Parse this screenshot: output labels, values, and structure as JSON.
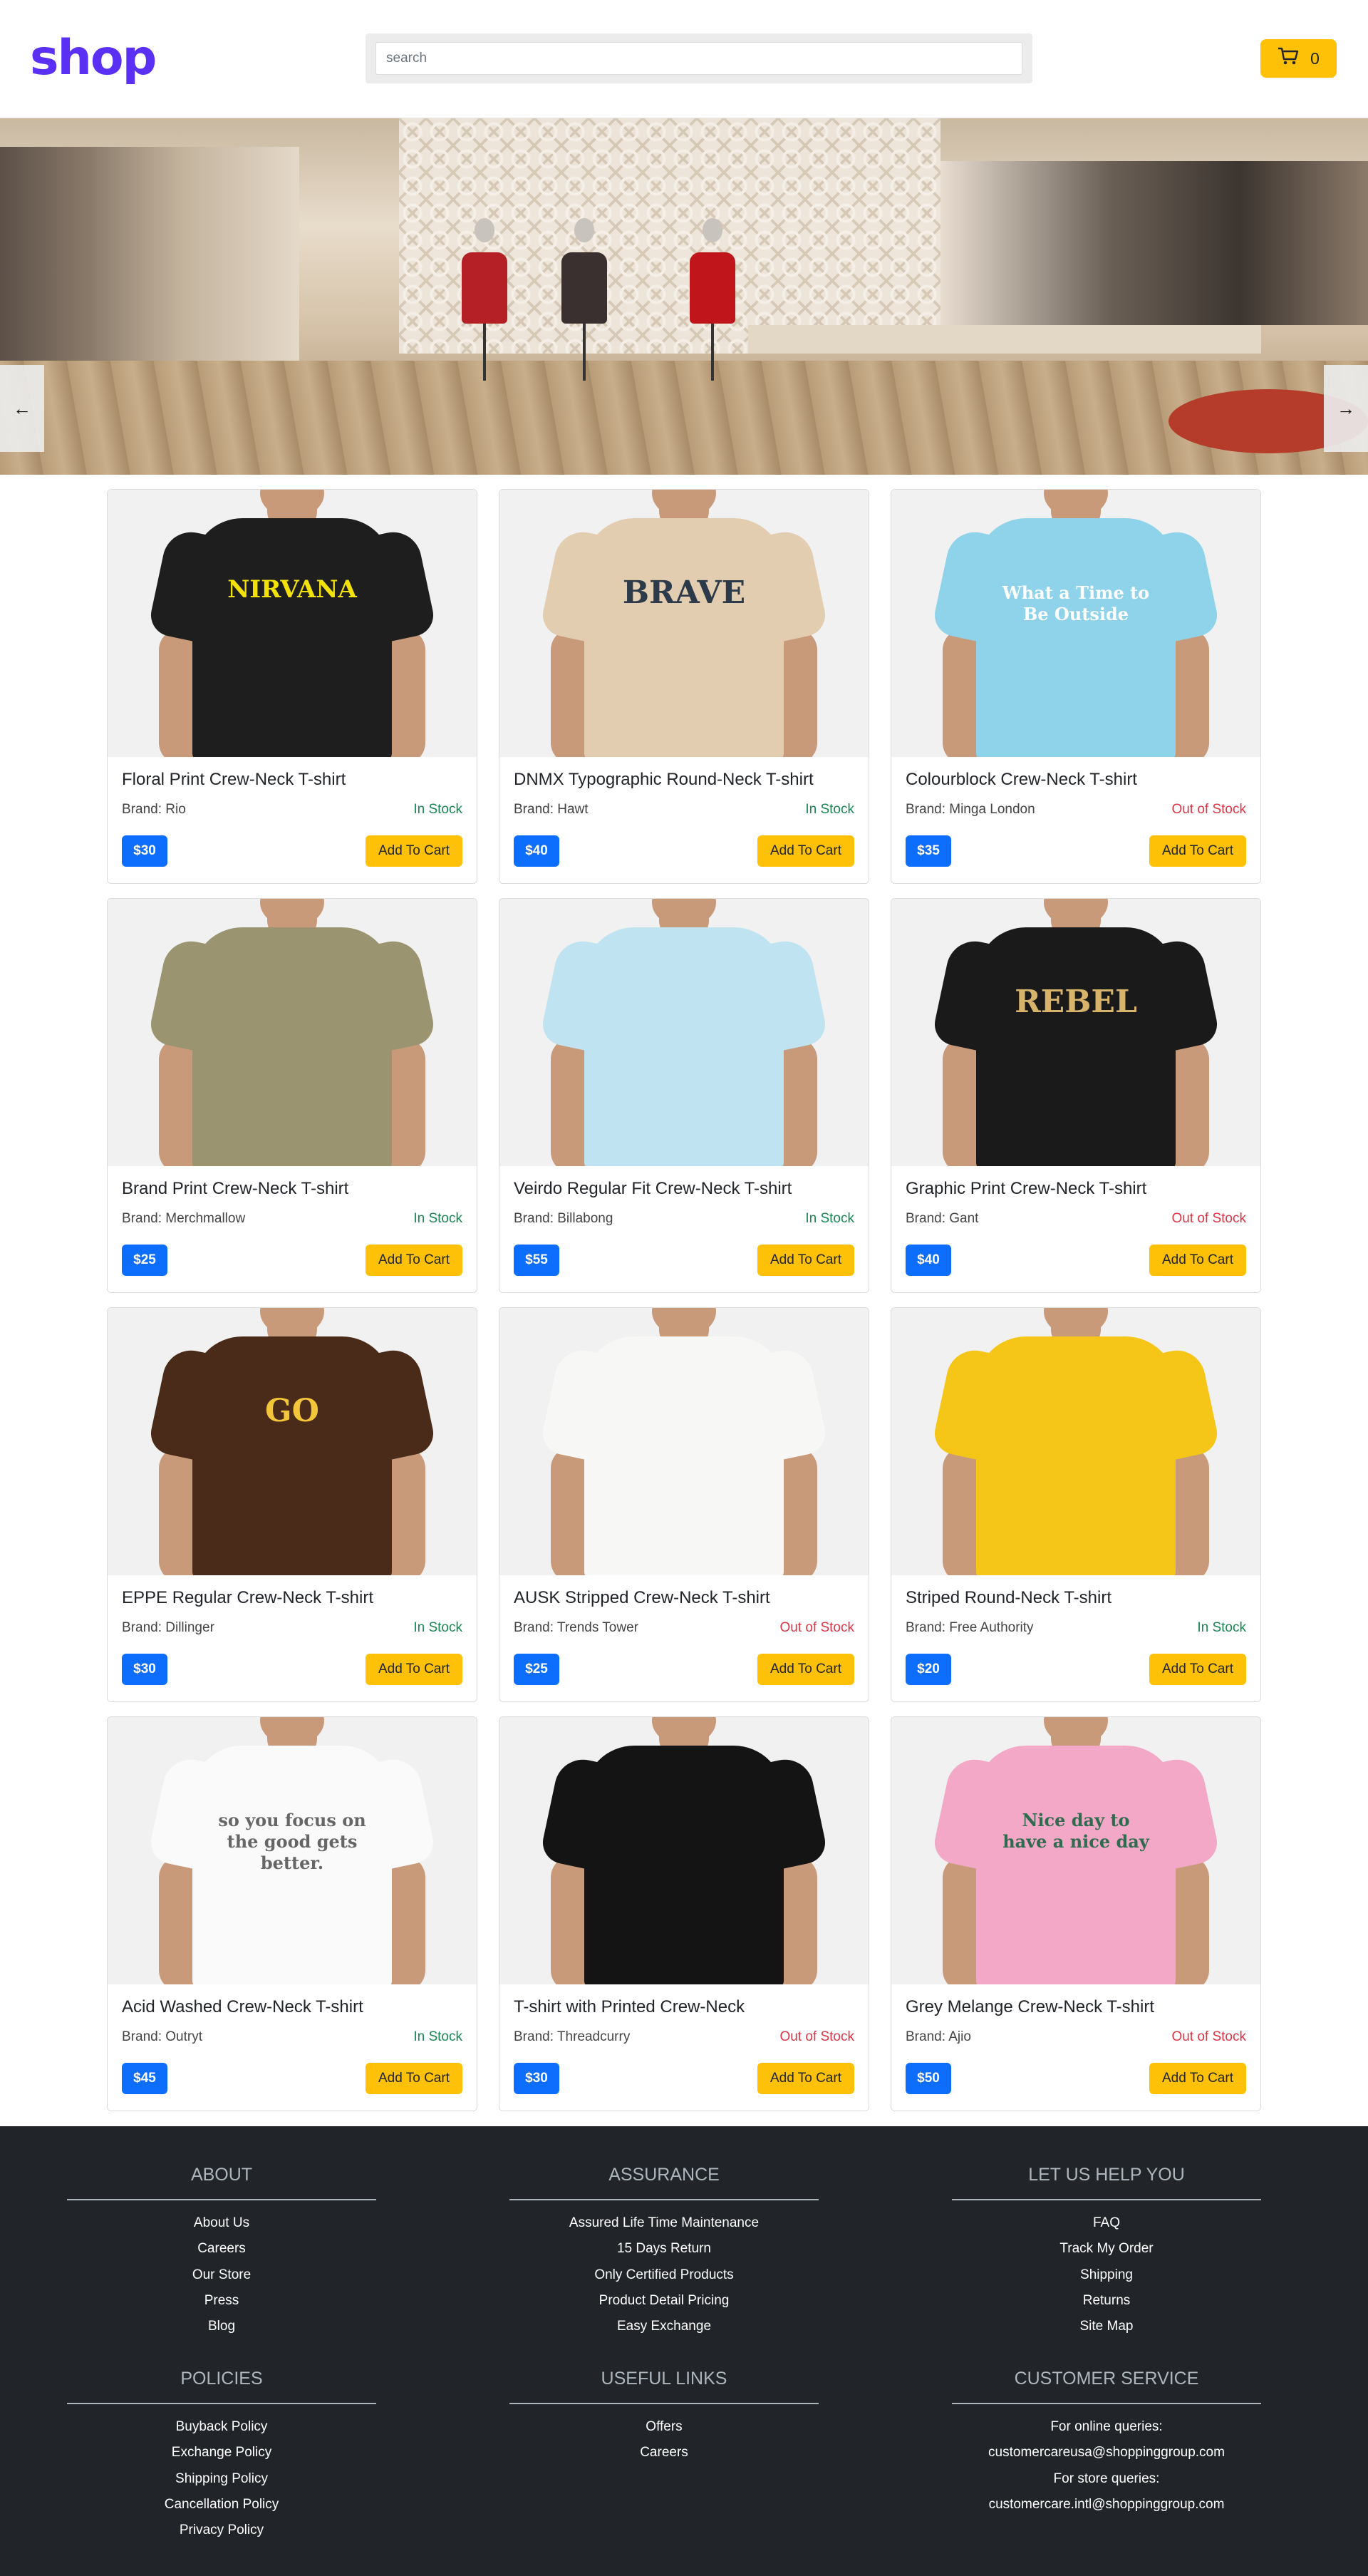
{
  "header": {
    "logo": "shop",
    "search_placeholder": "search",
    "cart_count": "0"
  },
  "banner": {
    "prev_label": "←",
    "next_label": "→"
  },
  "products": [
    {
      "title": "Floral Print Crew-Neck T-shirt",
      "brand": "Brand: Rio",
      "stock": "In Stock",
      "price": "$30",
      "add": "Add To Cart",
      "shirt_color": "#1e1e1e",
      "print": "NIRVANA",
      "print_color": "#f2e205"
    },
    {
      "title": "DNMX Typographic Round-Neck T-shirt",
      "brand": "Brand: Hawt",
      "stock": "In Stock",
      "price": "$40",
      "add": "Add To Cart",
      "shirt_color": "#e3cdb0",
      "print": "BRAVE",
      "print_color": "#2d3a4a"
    },
    {
      "title": "Colourblock Crew-Neck T-shirt",
      "brand": "Brand: Minga London",
      "stock": "Out of Stock",
      "price": "$35",
      "add": "Add To Cart",
      "shirt_color": "#8fd3ea",
      "print": "What a Time to Be Outside",
      "print_color": "#ffffff"
    },
    {
      "title": "Brand Print Crew-Neck T-shirt",
      "brand": "Brand: Merchmallow",
      "stock": "In Stock",
      "price": "$25",
      "add": "Add To Cart",
      "shirt_color": "#9a9470",
      "print": "",
      "print_color": "#ffffff"
    },
    {
      "title": "Veirdo Regular Fit Crew-Neck T-shirt",
      "brand": "Brand: Billabong",
      "stock": "In Stock",
      "price": "$55",
      "add": "Add To Cart",
      "shirt_color": "#bfe3f1",
      "print": "",
      "print_color": "#ffffff"
    },
    {
      "title": "Graphic Print Crew-Neck T-shirt",
      "brand": "Brand: Gant",
      "stock": "Out of Stock",
      "price": "$40",
      "add": "Add To Cart",
      "shirt_color": "#1a1a1a",
      "print": "REBEL",
      "print_color": "#d8b46a"
    },
    {
      "title": "EPPE Regular Crew-Neck T-shirt",
      "brand": "Brand: Dillinger",
      "stock": "In Stock",
      "price": "$30",
      "add": "Add To Cart",
      "shirt_color": "#4a2a18",
      "print": "GO",
      "print_color": "#f2c53a"
    },
    {
      "title": "AUSK Stripped Crew-Neck T-shirt",
      "brand": "Brand: Trends Tower",
      "stock": "Out of Stock",
      "price": "$25",
      "add": "Add To Cart",
      "shirt_color": "#f7f7f5",
      "print": "",
      "print_color": "#cccccc"
    },
    {
      "title": "Striped Round-Neck T-shirt",
      "brand": "Brand: Free Authority",
      "stock": "In Stock",
      "price": "$20",
      "add": "Add To Cart",
      "shirt_color": "#f5c518",
      "print": "",
      "print_color": "#111111"
    },
    {
      "title": "Acid Washed Crew-Neck T-shirt",
      "brand": "Brand: Outryt",
      "stock": "In Stock",
      "price": "$45",
      "add": "Add To Cart",
      "shirt_color": "#fafafa",
      "print": "so you focus on the good gets better.",
      "print_color": "#666666"
    },
    {
      "title": "T-shirt with Printed Crew-Neck",
      "brand": "Brand: Threadcurry",
      "stock": "Out of Stock",
      "price": "$30",
      "add": "Add To Cart",
      "shirt_color": "#141414",
      "print": "",
      "print_color": "#8e1522"
    },
    {
      "title": "Grey Melange Crew-Neck T-shirt",
      "brand": "Brand: Ajio",
      "stock": "Out of Stock",
      "price": "$50",
      "add": "Add To Cart",
      "shirt_color": "#f2a8c6",
      "print": "Nice day to have a nice day",
      "print_color": "#2f6b4f"
    }
  ],
  "footer": {
    "about": {
      "heading": "ABOUT",
      "links": [
        "About Us",
        "Careers",
        "Our Store",
        "Press",
        "Blog"
      ]
    },
    "assurance": {
      "heading": "ASSURANCE",
      "links": [
        "Assured Life Time Maintenance",
        "15 Days Return",
        "Only Certified Products",
        "Product Detail Pricing",
        "Easy Exchange"
      ]
    },
    "help": {
      "heading": "LET US HELP YOU",
      "links": [
        "FAQ",
        "Track My Order",
        "Shipping",
        "Returns",
        "Site Map"
      ]
    },
    "policies": {
      "heading": "POLICIES",
      "links": [
        "Buyback Policy",
        "Exchange Policy",
        "Shipping Policy",
        "Cancellation Policy",
        "Privacy Policy"
      ]
    },
    "useful": {
      "heading": "USEFUL LINKS",
      "links": [
        "Offers",
        "Careers"
      ]
    },
    "service": {
      "heading": "CUSTOMER SERVICE",
      "lines": [
        "For online queries:",
        "customercareusa@shoppinggroup.com",
        "For store queries:",
        "customercare.intl@shoppinggroup.com"
      ]
    }
  },
  "colors": {
    "accent": "#5a31f4",
    "price": "#0d6efd",
    "cart": "#ffc107",
    "in_stock": "#198754",
    "out_stock": "#dc3545",
    "footer_bg": "#212529"
  }
}
